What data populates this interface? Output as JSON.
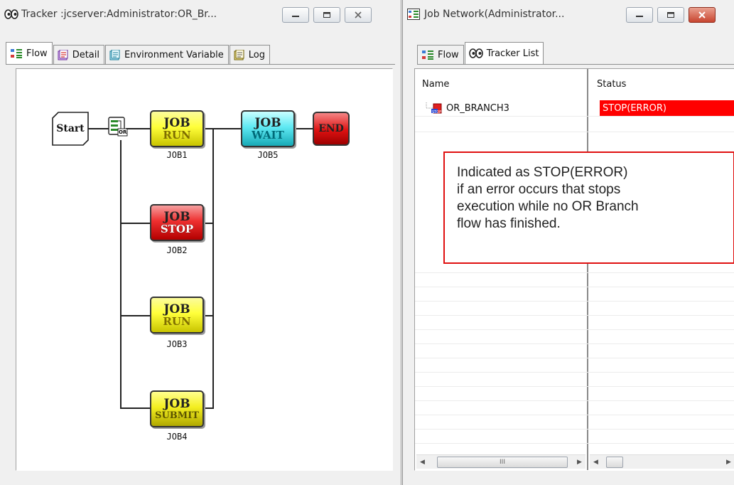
{
  "left_window": {
    "title": "Tracker :jcserver:Administrator:OR_Br...",
    "tabs": [
      {
        "label": "Flow",
        "icon": "flow-icon"
      },
      {
        "label": "Detail",
        "icon": "detail-icon"
      },
      {
        "label": "Environment Variable",
        "icon": "environment-variable-icon"
      },
      {
        "label": "Log",
        "icon": "log-icon"
      }
    ],
    "flow": {
      "start_label": "Start",
      "end_label": "END",
      "branch_icon_label": "OR",
      "jobs": [
        {
          "name": "JOB1",
          "line1": "JOB",
          "line2": "RUN",
          "state": "run"
        },
        {
          "name": "JOB2",
          "line1": "JOB",
          "line2": "STOP",
          "state": "stop"
        },
        {
          "name": "JOB3",
          "line1": "JOB",
          "line2": "RUN",
          "state": "run"
        },
        {
          "name": "JOB4",
          "line1": "JOB",
          "line2": "SUBMIT",
          "state": "submit"
        },
        {
          "name": "JOB5",
          "line1": "JOB",
          "line2": "WAIT",
          "state": "wait"
        }
      ]
    }
  },
  "right_window": {
    "title": "Job Network(Administrator...",
    "tabs": [
      {
        "label": "Flow",
        "icon": "flow-icon"
      },
      {
        "label": "Tracker List",
        "icon": "tracker-icon"
      }
    ],
    "list": {
      "columns": [
        "Name",
        "Status"
      ],
      "rows": [
        {
          "name": "OR_BRANCH3",
          "status": "STOP(ERROR)",
          "status_color": "#ff0000"
        }
      ]
    },
    "callout_lines": [
      "Indicated as STOP(ERROR)",
      "if an error occurs that stops",
      "execution while no OR Branch",
      "flow has finished."
    ],
    "scrollbar_grip": "III"
  }
}
